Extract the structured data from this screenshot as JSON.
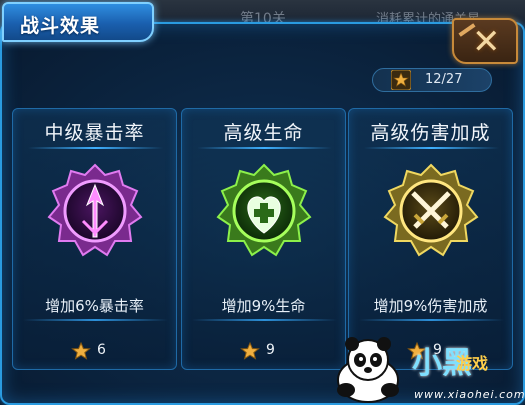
{
  "background": {
    "level_text": "第10关",
    "hint_text": "消耗累计的通关星"
  },
  "window": {
    "title": "战斗效果",
    "close_icon": "close-x-icon"
  },
  "stars": {
    "progress": "12/27"
  },
  "cards": [
    {
      "title": "中级暴击率",
      "description": "增加6%暴击率",
      "cost": "6",
      "emblem_icon": "arrow-crit-icon",
      "color": "#c64ad8"
    },
    {
      "title": "高级生命",
      "description": "增加9%生命",
      "cost": "9",
      "emblem_icon": "heart-plus-icon",
      "color": "#5ed22c"
    },
    {
      "title": "高级伤害加成",
      "description": "增加9%伤害加成",
      "cost": "9",
      "emblem_icon": "crossed-swords-icon",
      "color": "#cfb03a"
    }
  ],
  "watermark": {
    "logo": "小黑",
    "tagline": "游戏",
    "url": "www.xiaohei.com"
  },
  "colors": {
    "accent_blue": "#2a9be0",
    "star_gold": "#f0b040",
    "close_orange": "#c88a3a"
  }
}
